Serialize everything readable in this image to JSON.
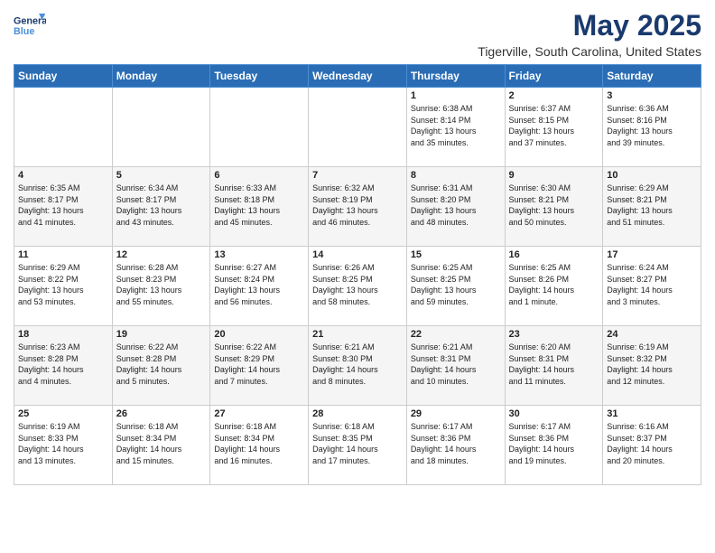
{
  "logo": {
    "general": "General",
    "blue": "Blue"
  },
  "title": "May 2025",
  "location": "Tigerville, South Carolina, United States",
  "days_of_week": [
    "Sunday",
    "Monday",
    "Tuesday",
    "Wednesday",
    "Thursday",
    "Friday",
    "Saturday"
  ],
  "weeks": [
    [
      {
        "day": "",
        "info": ""
      },
      {
        "day": "",
        "info": ""
      },
      {
        "day": "",
        "info": ""
      },
      {
        "day": "",
        "info": ""
      },
      {
        "day": "1",
        "info": "Sunrise: 6:38 AM\nSunset: 8:14 PM\nDaylight: 13 hours\nand 35 minutes."
      },
      {
        "day": "2",
        "info": "Sunrise: 6:37 AM\nSunset: 8:15 PM\nDaylight: 13 hours\nand 37 minutes."
      },
      {
        "day": "3",
        "info": "Sunrise: 6:36 AM\nSunset: 8:16 PM\nDaylight: 13 hours\nand 39 minutes."
      }
    ],
    [
      {
        "day": "4",
        "info": "Sunrise: 6:35 AM\nSunset: 8:17 PM\nDaylight: 13 hours\nand 41 minutes."
      },
      {
        "day": "5",
        "info": "Sunrise: 6:34 AM\nSunset: 8:17 PM\nDaylight: 13 hours\nand 43 minutes."
      },
      {
        "day": "6",
        "info": "Sunrise: 6:33 AM\nSunset: 8:18 PM\nDaylight: 13 hours\nand 45 minutes."
      },
      {
        "day": "7",
        "info": "Sunrise: 6:32 AM\nSunset: 8:19 PM\nDaylight: 13 hours\nand 46 minutes."
      },
      {
        "day": "8",
        "info": "Sunrise: 6:31 AM\nSunset: 8:20 PM\nDaylight: 13 hours\nand 48 minutes."
      },
      {
        "day": "9",
        "info": "Sunrise: 6:30 AM\nSunset: 8:21 PM\nDaylight: 13 hours\nand 50 minutes."
      },
      {
        "day": "10",
        "info": "Sunrise: 6:29 AM\nSunset: 8:21 PM\nDaylight: 13 hours\nand 51 minutes."
      }
    ],
    [
      {
        "day": "11",
        "info": "Sunrise: 6:29 AM\nSunset: 8:22 PM\nDaylight: 13 hours\nand 53 minutes."
      },
      {
        "day": "12",
        "info": "Sunrise: 6:28 AM\nSunset: 8:23 PM\nDaylight: 13 hours\nand 55 minutes."
      },
      {
        "day": "13",
        "info": "Sunrise: 6:27 AM\nSunset: 8:24 PM\nDaylight: 13 hours\nand 56 minutes."
      },
      {
        "day": "14",
        "info": "Sunrise: 6:26 AM\nSunset: 8:25 PM\nDaylight: 13 hours\nand 58 minutes."
      },
      {
        "day": "15",
        "info": "Sunrise: 6:25 AM\nSunset: 8:25 PM\nDaylight: 13 hours\nand 59 minutes."
      },
      {
        "day": "16",
        "info": "Sunrise: 6:25 AM\nSunset: 8:26 PM\nDaylight: 14 hours\nand 1 minute."
      },
      {
        "day": "17",
        "info": "Sunrise: 6:24 AM\nSunset: 8:27 PM\nDaylight: 14 hours\nand 3 minutes."
      }
    ],
    [
      {
        "day": "18",
        "info": "Sunrise: 6:23 AM\nSunset: 8:28 PM\nDaylight: 14 hours\nand 4 minutes."
      },
      {
        "day": "19",
        "info": "Sunrise: 6:22 AM\nSunset: 8:28 PM\nDaylight: 14 hours\nand 5 minutes."
      },
      {
        "day": "20",
        "info": "Sunrise: 6:22 AM\nSunset: 8:29 PM\nDaylight: 14 hours\nand 7 minutes."
      },
      {
        "day": "21",
        "info": "Sunrise: 6:21 AM\nSunset: 8:30 PM\nDaylight: 14 hours\nand 8 minutes."
      },
      {
        "day": "22",
        "info": "Sunrise: 6:21 AM\nSunset: 8:31 PM\nDaylight: 14 hours\nand 10 minutes."
      },
      {
        "day": "23",
        "info": "Sunrise: 6:20 AM\nSunset: 8:31 PM\nDaylight: 14 hours\nand 11 minutes."
      },
      {
        "day": "24",
        "info": "Sunrise: 6:19 AM\nSunset: 8:32 PM\nDaylight: 14 hours\nand 12 minutes."
      }
    ],
    [
      {
        "day": "25",
        "info": "Sunrise: 6:19 AM\nSunset: 8:33 PM\nDaylight: 14 hours\nand 13 minutes."
      },
      {
        "day": "26",
        "info": "Sunrise: 6:18 AM\nSunset: 8:34 PM\nDaylight: 14 hours\nand 15 minutes."
      },
      {
        "day": "27",
        "info": "Sunrise: 6:18 AM\nSunset: 8:34 PM\nDaylight: 14 hours\nand 16 minutes."
      },
      {
        "day": "28",
        "info": "Sunrise: 6:18 AM\nSunset: 8:35 PM\nDaylight: 14 hours\nand 17 minutes."
      },
      {
        "day": "29",
        "info": "Sunrise: 6:17 AM\nSunset: 8:36 PM\nDaylight: 14 hours\nand 18 minutes."
      },
      {
        "day": "30",
        "info": "Sunrise: 6:17 AM\nSunset: 8:36 PM\nDaylight: 14 hours\nand 19 minutes."
      },
      {
        "day": "31",
        "info": "Sunrise: 6:16 AM\nSunset: 8:37 PM\nDaylight: 14 hours\nand 20 minutes."
      }
    ]
  ]
}
